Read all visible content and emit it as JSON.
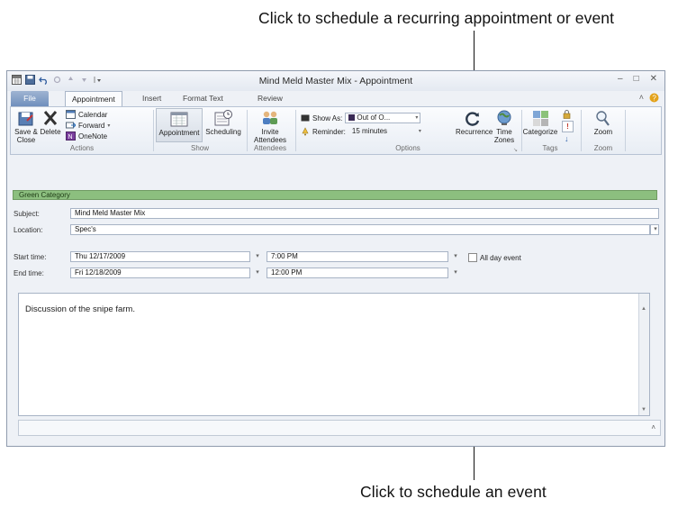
{
  "callouts": {
    "top": "Click to schedule a recurring appointment or event",
    "bottom": "Click to schedule an event"
  },
  "window": {
    "title": "Mind Meld Master Mix  -  Appointment"
  },
  "tabs": [
    "File",
    "Appointment",
    "Insert",
    "Format Text",
    "Review"
  ],
  "ribbon": {
    "save_close": "Save & Close",
    "delete": "Delete",
    "calendar": "Calendar",
    "forward": "Forward",
    "onenote": "OneNote",
    "group_actions": "Actions",
    "appointment": "Appointment",
    "scheduling": "Scheduling",
    "group_show": "Show",
    "invite": "Invite Attendees",
    "group_attendees": "Attendees",
    "show_as_label": "Show As:",
    "show_as_value": "Out of O...",
    "reminder_label": "Reminder:",
    "reminder_value": "15 minutes",
    "recurrence": "Recurrence",
    "time_zones": "Time Zones",
    "group_options": "Options",
    "categorize": "Categorize",
    "group_tags": "Tags",
    "zoom": "Zoom",
    "group_zoom": "Zoom"
  },
  "form": {
    "category": "Green Category",
    "subject_label": "Subject:",
    "subject_value": "Mind Meld Master Mix",
    "location_label": "Location:",
    "location_value": "Spec's",
    "start_label": "Start time:",
    "start_date": "Thu 12/17/2009",
    "start_time": "7:00 PM",
    "all_day": "All day event",
    "end_label": "End time:",
    "end_date": "Fri 12/18/2009",
    "end_time": "12:00 PM",
    "body": "Discussion of the snipe farm."
  },
  "colors": {
    "category": "#8cbf7f",
    "file_tab": "#6f8fbd"
  }
}
